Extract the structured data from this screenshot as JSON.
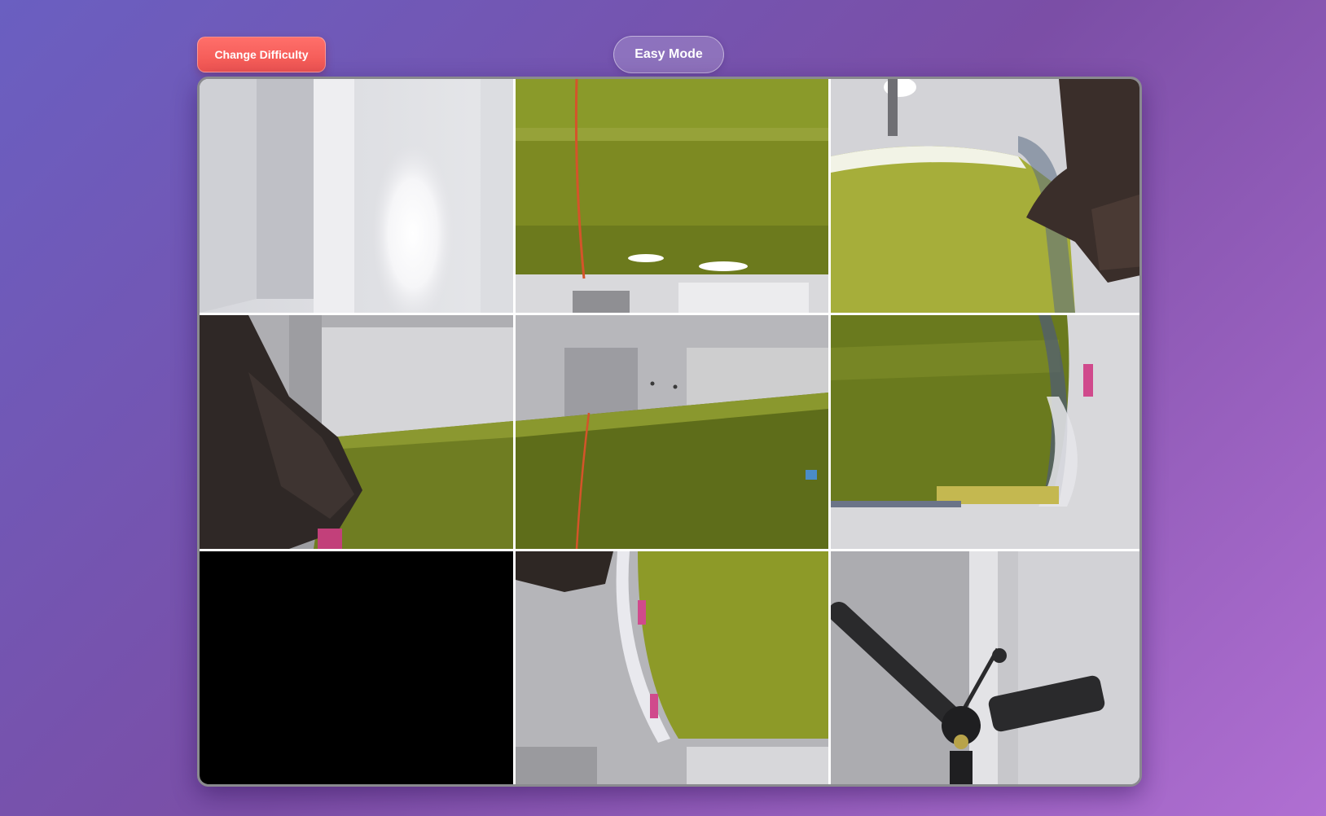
{
  "header": {
    "change_difficulty_label": "Change Difficulty",
    "mode_label": "Easy Mode"
  },
  "puzzle": {
    "grid_size": 3,
    "empty_tile_index": 6,
    "tiles": [
      {
        "index": 0,
        "content": "ceiling-corner-light"
      },
      {
        "index": 1,
        "content": "green-tube-top"
      },
      {
        "index": 2,
        "content": "green-tube-end-hand"
      },
      {
        "index": 3,
        "content": "hand-holding-tube"
      },
      {
        "index": 4,
        "content": "green-tube-middle"
      },
      {
        "index": 5,
        "content": "green-tube-wrapped-end"
      },
      {
        "index": 6,
        "content": "empty"
      },
      {
        "index": 7,
        "content": "green-tube-bottom-hand"
      },
      {
        "index": 8,
        "content": "ceiling-fan"
      }
    ]
  },
  "colors": {
    "background_start": "#6a5fc1",
    "background_end": "#b06fd2",
    "change_button": "#ef5350",
    "board_border": "#8a8a8f",
    "empty_tile": "#000000",
    "tube_green": "#8a9a2a"
  }
}
